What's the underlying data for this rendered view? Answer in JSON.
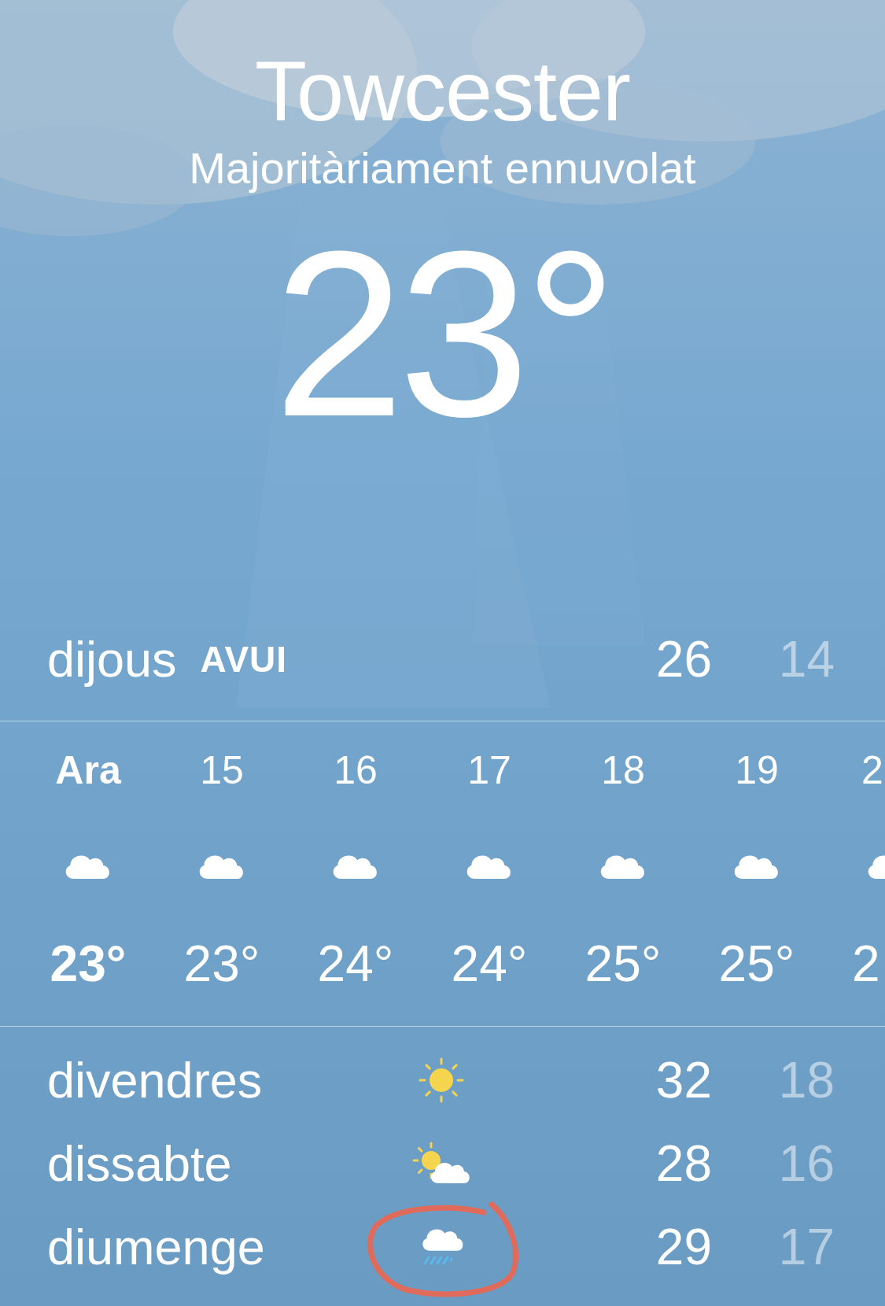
{
  "location": {
    "city": "Towcester",
    "condition": "Majoritàriament ennuvolat",
    "temperature": "23°"
  },
  "today": {
    "day": "dijous",
    "label": "AVUI",
    "high": "26",
    "low": "14"
  },
  "hourly": [
    {
      "time": "Ara",
      "kind": "cloud",
      "temp": "23°",
      "now": true
    },
    {
      "time": "15",
      "kind": "cloud",
      "temp": "23°",
      "now": false
    },
    {
      "time": "16",
      "kind": "cloud",
      "temp": "24°",
      "now": false
    },
    {
      "time": "17",
      "kind": "cloud",
      "temp": "24°",
      "now": false
    },
    {
      "time": "18",
      "kind": "cloud",
      "temp": "25°",
      "now": false
    },
    {
      "time": "19",
      "kind": "cloud",
      "temp": "25°",
      "now": false
    },
    {
      "time": "2",
      "kind": "cloud",
      "temp": "2",
      "now": false
    }
  ],
  "daily": [
    {
      "day": "divendres",
      "kind": "sun",
      "high": "32",
      "low": "18",
      "circled": false
    },
    {
      "day": "dissabte",
      "kind": "sun-cloud",
      "high": "28",
      "low": "16",
      "circled": false
    },
    {
      "day": "diumenge",
      "kind": "rain",
      "high": "29",
      "low": "17",
      "circled": true
    }
  ]
}
